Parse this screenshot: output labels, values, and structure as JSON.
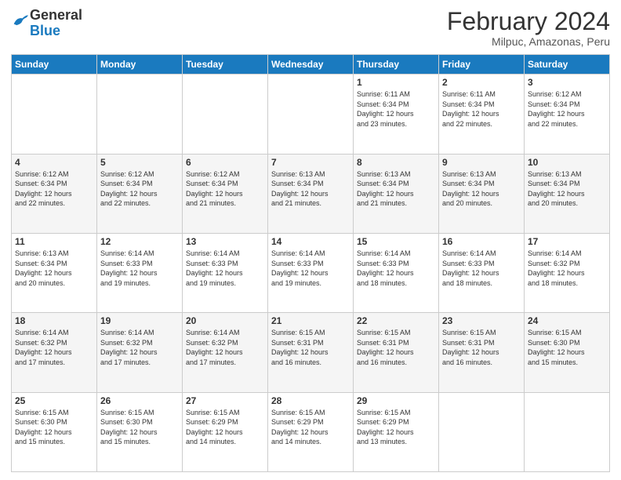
{
  "logo": {
    "general": "General",
    "blue": "Blue"
  },
  "header": {
    "title": "February 2024",
    "subtitle": "Milpuc, Amazonas, Peru"
  },
  "days_of_week": [
    "Sunday",
    "Monday",
    "Tuesday",
    "Wednesday",
    "Thursday",
    "Friday",
    "Saturday"
  ],
  "weeks": [
    [
      {
        "day": "",
        "info": ""
      },
      {
        "day": "",
        "info": ""
      },
      {
        "day": "",
        "info": ""
      },
      {
        "day": "",
        "info": ""
      },
      {
        "day": "1",
        "info": "Sunrise: 6:11 AM\nSunset: 6:34 PM\nDaylight: 12 hours\nand 23 minutes."
      },
      {
        "day": "2",
        "info": "Sunrise: 6:11 AM\nSunset: 6:34 PM\nDaylight: 12 hours\nand 22 minutes."
      },
      {
        "day": "3",
        "info": "Sunrise: 6:12 AM\nSunset: 6:34 PM\nDaylight: 12 hours\nand 22 minutes."
      }
    ],
    [
      {
        "day": "4",
        "info": "Sunrise: 6:12 AM\nSunset: 6:34 PM\nDaylight: 12 hours\nand 22 minutes."
      },
      {
        "day": "5",
        "info": "Sunrise: 6:12 AM\nSunset: 6:34 PM\nDaylight: 12 hours\nand 22 minutes."
      },
      {
        "day": "6",
        "info": "Sunrise: 6:12 AM\nSunset: 6:34 PM\nDaylight: 12 hours\nand 21 minutes."
      },
      {
        "day": "7",
        "info": "Sunrise: 6:13 AM\nSunset: 6:34 PM\nDaylight: 12 hours\nand 21 minutes."
      },
      {
        "day": "8",
        "info": "Sunrise: 6:13 AM\nSunset: 6:34 PM\nDaylight: 12 hours\nand 21 minutes."
      },
      {
        "day": "9",
        "info": "Sunrise: 6:13 AM\nSunset: 6:34 PM\nDaylight: 12 hours\nand 20 minutes."
      },
      {
        "day": "10",
        "info": "Sunrise: 6:13 AM\nSunset: 6:34 PM\nDaylight: 12 hours\nand 20 minutes."
      }
    ],
    [
      {
        "day": "11",
        "info": "Sunrise: 6:13 AM\nSunset: 6:34 PM\nDaylight: 12 hours\nand 20 minutes."
      },
      {
        "day": "12",
        "info": "Sunrise: 6:14 AM\nSunset: 6:33 PM\nDaylight: 12 hours\nand 19 minutes."
      },
      {
        "day": "13",
        "info": "Sunrise: 6:14 AM\nSunset: 6:33 PM\nDaylight: 12 hours\nand 19 minutes."
      },
      {
        "day": "14",
        "info": "Sunrise: 6:14 AM\nSunset: 6:33 PM\nDaylight: 12 hours\nand 19 minutes."
      },
      {
        "day": "15",
        "info": "Sunrise: 6:14 AM\nSunset: 6:33 PM\nDaylight: 12 hours\nand 18 minutes."
      },
      {
        "day": "16",
        "info": "Sunrise: 6:14 AM\nSunset: 6:33 PM\nDaylight: 12 hours\nand 18 minutes."
      },
      {
        "day": "17",
        "info": "Sunrise: 6:14 AM\nSunset: 6:32 PM\nDaylight: 12 hours\nand 18 minutes."
      }
    ],
    [
      {
        "day": "18",
        "info": "Sunrise: 6:14 AM\nSunset: 6:32 PM\nDaylight: 12 hours\nand 17 minutes."
      },
      {
        "day": "19",
        "info": "Sunrise: 6:14 AM\nSunset: 6:32 PM\nDaylight: 12 hours\nand 17 minutes."
      },
      {
        "day": "20",
        "info": "Sunrise: 6:14 AM\nSunset: 6:32 PM\nDaylight: 12 hours\nand 17 minutes."
      },
      {
        "day": "21",
        "info": "Sunrise: 6:15 AM\nSunset: 6:31 PM\nDaylight: 12 hours\nand 16 minutes."
      },
      {
        "day": "22",
        "info": "Sunrise: 6:15 AM\nSunset: 6:31 PM\nDaylight: 12 hours\nand 16 minutes."
      },
      {
        "day": "23",
        "info": "Sunrise: 6:15 AM\nSunset: 6:31 PM\nDaylight: 12 hours\nand 16 minutes."
      },
      {
        "day": "24",
        "info": "Sunrise: 6:15 AM\nSunset: 6:30 PM\nDaylight: 12 hours\nand 15 minutes."
      }
    ],
    [
      {
        "day": "25",
        "info": "Sunrise: 6:15 AM\nSunset: 6:30 PM\nDaylight: 12 hours\nand 15 minutes."
      },
      {
        "day": "26",
        "info": "Sunrise: 6:15 AM\nSunset: 6:30 PM\nDaylight: 12 hours\nand 15 minutes."
      },
      {
        "day": "27",
        "info": "Sunrise: 6:15 AM\nSunset: 6:29 PM\nDaylight: 12 hours\nand 14 minutes."
      },
      {
        "day": "28",
        "info": "Sunrise: 6:15 AM\nSunset: 6:29 PM\nDaylight: 12 hours\nand 14 minutes."
      },
      {
        "day": "29",
        "info": "Sunrise: 6:15 AM\nSunset: 6:29 PM\nDaylight: 12 hours\nand 13 minutes."
      },
      {
        "day": "",
        "info": ""
      },
      {
        "day": "",
        "info": ""
      }
    ]
  ]
}
